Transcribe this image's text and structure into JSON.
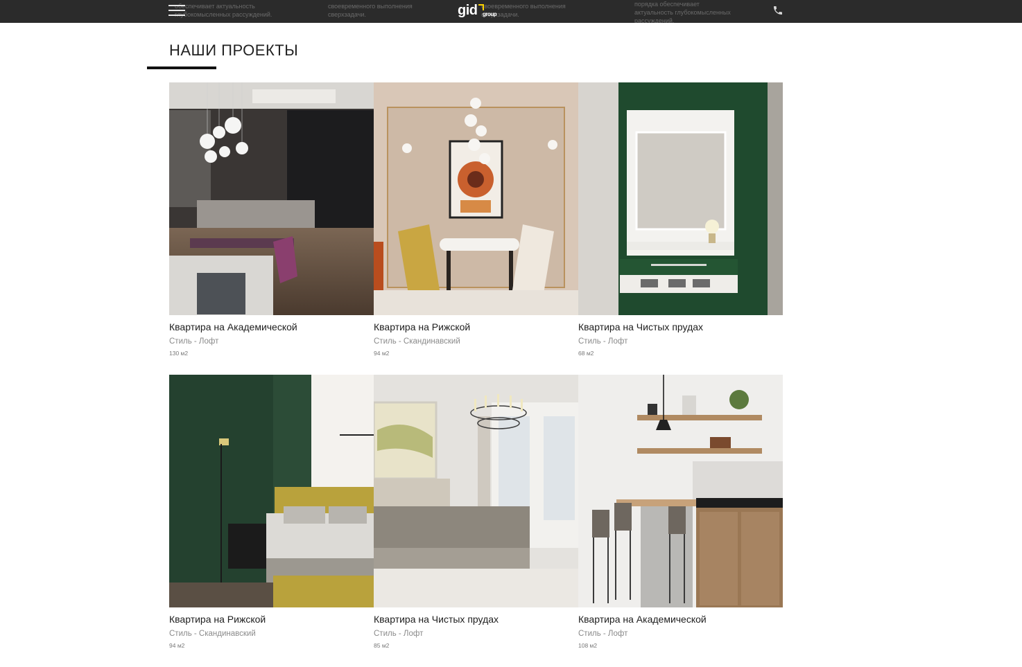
{
  "header": {
    "logo_main": "gid",
    "logo_sub": "group",
    "background_texts": [
      {
        "lines": [
          "обеспечивает актуальность",
          "глубокомысленных рассуждений."
        ]
      },
      {
        "lines": [
          "своевременного выполнения",
          "сверхзадачи."
        ]
      },
      {
        "lines": [
          "своевременного выполнения",
          "сверхзадачи."
        ]
      },
      {
        "lines": [
          "порядка обеспечивает",
          "актуальность глубокомысленных",
          "рассуждений."
        ]
      }
    ],
    "menu_icon": "hamburger-icon",
    "phone_icon": "phone-icon"
  },
  "section": {
    "title": "НАШИ ПРОЕКТЫ"
  },
  "projects": [
    {
      "name": "Квартира на Академической",
      "style": "Стиль - Лофт",
      "area": "130 м2",
      "photo": "kitchen-dining-dark"
    },
    {
      "name": "Квартира на Рижской",
      "style": "Стиль - Скандинавский",
      "area": "94 м2",
      "photo": "dining-beige"
    },
    {
      "name": "Квартира на Чистых прудах",
      "style": "Стиль - Лофт",
      "area": "68 м2",
      "photo": "bathroom-green"
    },
    {
      "name": "Квартира на Рижской",
      "style": "Стиль - Скандинавский",
      "area": "94 м2",
      "photo": "bedroom-green"
    },
    {
      "name": "Квартира на Чистых прудах",
      "style": "Стиль - Лофт",
      "area": "85 м2",
      "photo": "bedroom-grey"
    },
    {
      "name": "Квартира на Академической",
      "style": "Стиль - Лофт",
      "area": "108 м2",
      "photo": "kitchen-bar"
    }
  ],
  "colors": {
    "topbar": "#2b2b2b",
    "logo_accent": "#ffd400",
    "underline": "#111111"
  }
}
